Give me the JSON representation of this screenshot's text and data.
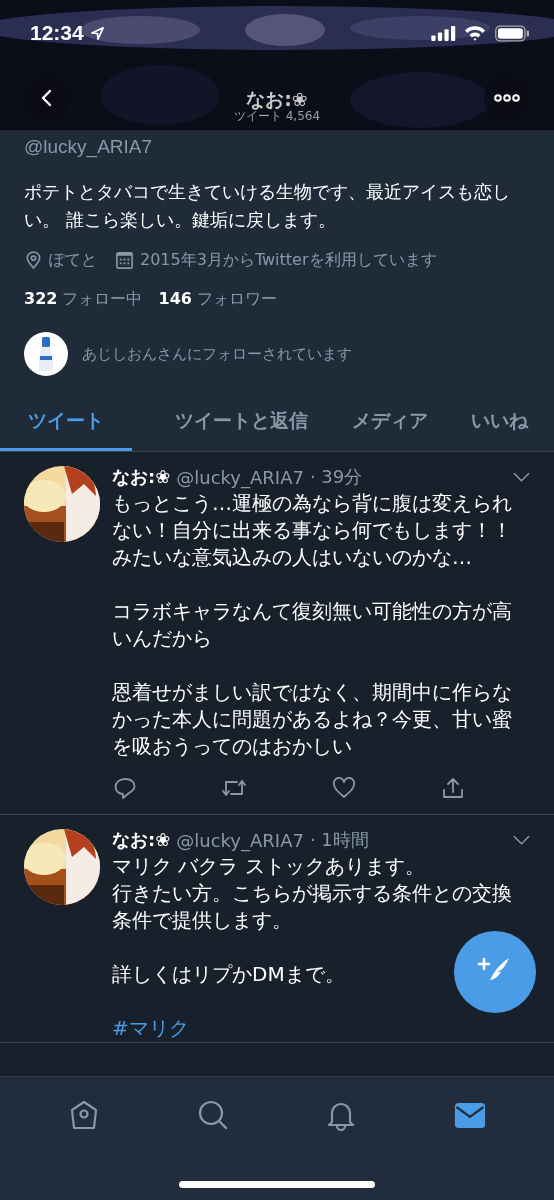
{
  "status_bar": {
    "time": "12:34"
  },
  "header": {
    "name": "なお:❀",
    "subtitle": "ツイート 4,564"
  },
  "profile": {
    "handle": "@lucky_ARIA7",
    "bio": "ポテトとタバコで生きていける生物です、最近アイスも恋しい。 誰こら楽しい。鍵垢に戻します。",
    "location": "ぽてと",
    "joined": "2015年3月からTwitterを利用しています",
    "following_count": "322",
    "following_label": "フォロー中",
    "followers_count": "146",
    "followers_label": "フォロワー",
    "followed_by": "あじしおんさんにフォローされています"
  },
  "tabs": [
    {
      "label": "ツイート",
      "selected": true
    },
    {
      "label": "ツイートと返信",
      "selected": false
    },
    {
      "label": "メディア",
      "selected": false
    },
    {
      "label": "いいね",
      "selected": false
    }
  ],
  "tweets": [
    {
      "name": "なお:❀",
      "handle": "@lucky_ARIA7",
      "time": "· 39分",
      "paragraphs": [
        [
          "もっとこう…運極の為なら背に腹は変えられない！自分に出来る事なら何でもします！！みたいな意気込みの人はいないのかな…"
        ],
        [
          "コラボキャラなんて復刻無い可能性の方が高いんだから"
        ],
        [
          "恩着せがましい訳ではなく、期間中に作らなかった本人に問題があるよね？今更、甘い蜜を吸おうってのはおかしい"
        ]
      ]
    },
    {
      "name": "なお:❀",
      "handle": "@lucky_ARIA7",
      "time": "· 1時間",
      "paragraphs": [
        [
          "マリク バクラ ストックあります。",
          "行きたい方。こちらが掲示する条件との交換条件で提供します。"
        ],
        [
          "詳しくはリプかDMまで。"
        ]
      ],
      "hashtag": "#マリク"
    }
  ],
  "nav": [
    {
      "kind": "home",
      "selected": false
    },
    {
      "kind": "search",
      "selected": false
    },
    {
      "kind": "notifications",
      "selected": false
    },
    {
      "kind": "messages",
      "selected": true
    }
  ]
}
